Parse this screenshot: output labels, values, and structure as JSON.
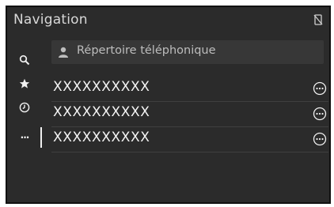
{
  "header": {
    "title": "Navigation"
  },
  "search": {
    "placeholder": "Répertoire téléphonique"
  },
  "contacts": [
    {
      "name": "XXXXXXXXXX"
    },
    {
      "name": "XXXXXXXXXX"
    },
    {
      "name": "XXXXXXXXXX"
    }
  ],
  "sidebar": {
    "icons": [
      "search-icon",
      "star-icon",
      "clock-icon",
      "more-icon"
    ],
    "more_glyph": "···"
  },
  "colors": {
    "background": "#2b2b2b",
    "text": "#f4f4f4",
    "field": "#373737"
  }
}
